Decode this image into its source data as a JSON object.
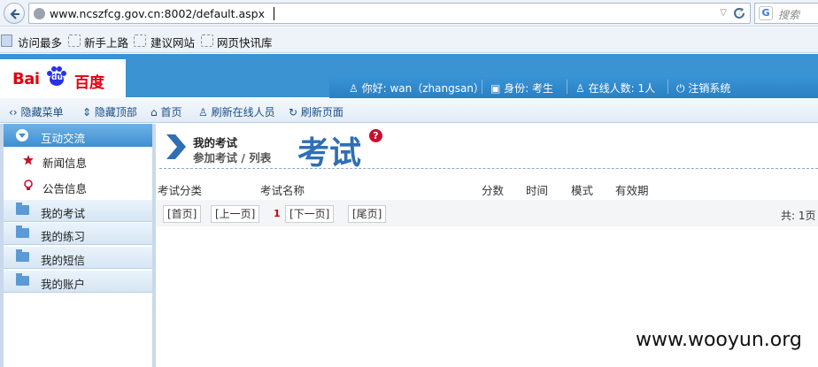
{
  "browser": {
    "url": "www.ncszfcg.gov.cn:8002/default.aspx",
    "search_placeholder": "搜索",
    "search_engine_icon": "G"
  },
  "bookmarks": [
    "访问最多",
    "新手上路",
    "建议网站",
    "网页快讯库"
  ],
  "logo": {
    "left": "Bai",
    "du": "du",
    "right": "百度"
  },
  "user_bar": {
    "greeting": "你好: wan（zhangsan）",
    "identity": "身份: 考生",
    "online": "在线人数: 1人",
    "logout": "注销系统"
  },
  "toolbar": {
    "hide_menu": "隐藏菜单",
    "hide_top": "隐藏顶部",
    "home": "首页",
    "refresh_online": "刷新在线人员",
    "refresh_page": "刷新页面"
  },
  "sidebar": {
    "active_group": "互动交流",
    "sub_items": [
      "新闻信息",
      "公告信息"
    ],
    "groups": [
      "我的考试",
      "我的练习",
      "我的短信",
      "我的账户"
    ]
  },
  "main": {
    "title": "我的考试",
    "subtitle": "参加考试 / 列表",
    "big_title": "考试",
    "help_icon": "?",
    "columns": [
      "考试分类",
      "考试名称",
      "分数",
      "时间",
      "模式",
      "有效期"
    ],
    "pager": {
      "first": "[首页]",
      "prev": "[上一页]",
      "current": "1",
      "next": "[下一页]",
      "last": "[尾页]",
      "total": "共: 1页"
    }
  },
  "watermark": "www.wooyun.org",
  "colors": {
    "header_blue": "#3b93d2",
    "accent_red": "#c8102e",
    "title_blue": "#2f6fb4"
  }
}
